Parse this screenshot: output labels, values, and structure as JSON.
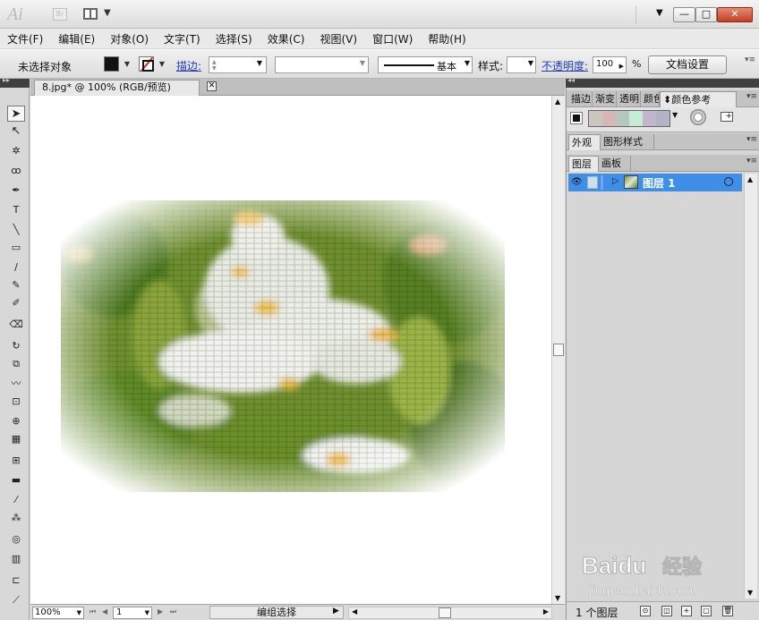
{
  "app": {
    "logo": "Ai",
    "bridge": "Br"
  },
  "window": {
    "min": "—",
    "max": "□",
    "close": "✕"
  },
  "menu": [
    "文件(F)",
    "编辑(E)",
    "对象(O)",
    "文字(T)",
    "选择(S)",
    "效果(C)",
    "视图(V)",
    "窗口(W)",
    "帮助(H)"
  ],
  "control": {
    "selection": "未选择对象",
    "stroke_label": "描边:",
    "brush": "基本",
    "style_label": "样式:",
    "opacity_label": "不透明度:",
    "opacity": "100",
    "opacity_unit": "%",
    "doc_setup": "文档设置"
  },
  "document": {
    "tab": "8.jpg* @ 100% (RGB/预览)",
    "zoom": "100%",
    "page": "1",
    "status": "编组选择"
  },
  "tools": [
    {
      "name": "selection-tool-icon",
      "g": "➤"
    },
    {
      "name": "direct-selection-tool-icon",
      "g": "↖"
    },
    {
      "name": "magic-wand-tool-icon",
      "g": "✲"
    },
    {
      "name": "lasso-tool-icon",
      "g": "ꝏ"
    },
    {
      "name": "pen-tool-icon",
      "g": "✒"
    },
    {
      "name": "type-tool-icon",
      "g": "T"
    },
    {
      "name": "line-tool-icon",
      "g": "╲"
    },
    {
      "name": "rectangle-tool-icon",
      "g": "▭"
    },
    {
      "name": "paintbrush-tool-icon",
      "g": "∕"
    },
    {
      "name": "pencil-tool-icon",
      "g": "✎"
    },
    {
      "name": "blob-brush-tool-icon",
      "g": "✐"
    },
    {
      "name": "eraser-tool-icon",
      "g": "⌫"
    },
    {
      "name": "rotate-tool-icon",
      "g": "↻"
    },
    {
      "name": "scale-tool-icon",
      "g": "⧉"
    },
    {
      "name": "warp-tool-icon",
      "g": "〰"
    },
    {
      "name": "free-transform-tool-icon",
      "g": "⊡"
    },
    {
      "name": "shape-builder-tool-icon",
      "g": "⊕"
    },
    {
      "name": "perspective-grid-tool-icon",
      "g": "▦"
    },
    {
      "name": "mesh-tool-icon",
      "g": "⊞"
    },
    {
      "name": "gradient-tool-icon",
      "g": "▬"
    },
    {
      "name": "eyedropper-tool-icon",
      "g": "⁄"
    },
    {
      "name": "blend-tool-icon",
      "g": "⁂"
    },
    {
      "name": "symbol-sprayer-tool-icon",
      "g": "◎"
    },
    {
      "name": "column-graph-tool-icon",
      "g": "▥"
    },
    {
      "name": "artboard-tool-icon",
      "g": "⊏"
    },
    {
      "name": "slice-tool-icon",
      "g": "⟋"
    }
  ],
  "panels": {
    "color_tabs": [
      "描边",
      "渐变",
      "透明",
      "颜色",
      "颜色参考"
    ],
    "color_guide_strip": [
      "#c8c6bf",
      "#d6b7b3",
      "#b6c7bf",
      "#c6ecd3",
      "#c3b5ce",
      "#b1b3c7"
    ],
    "appearance_tabs": [
      "外观",
      "图形样式"
    ],
    "layers_tabs": [
      "图层",
      "画板"
    ],
    "layer_name": "图层 1",
    "layer_count": "1 个图层"
  },
  "colors": {
    "accent": "#3f8fe6",
    "close_btn": "#c1401f",
    "link": "#1d3fb6"
  },
  "watermark": {
    "brand": "Baidu",
    "sub": "经验",
    "url": "jingyan.baidu.com"
  }
}
